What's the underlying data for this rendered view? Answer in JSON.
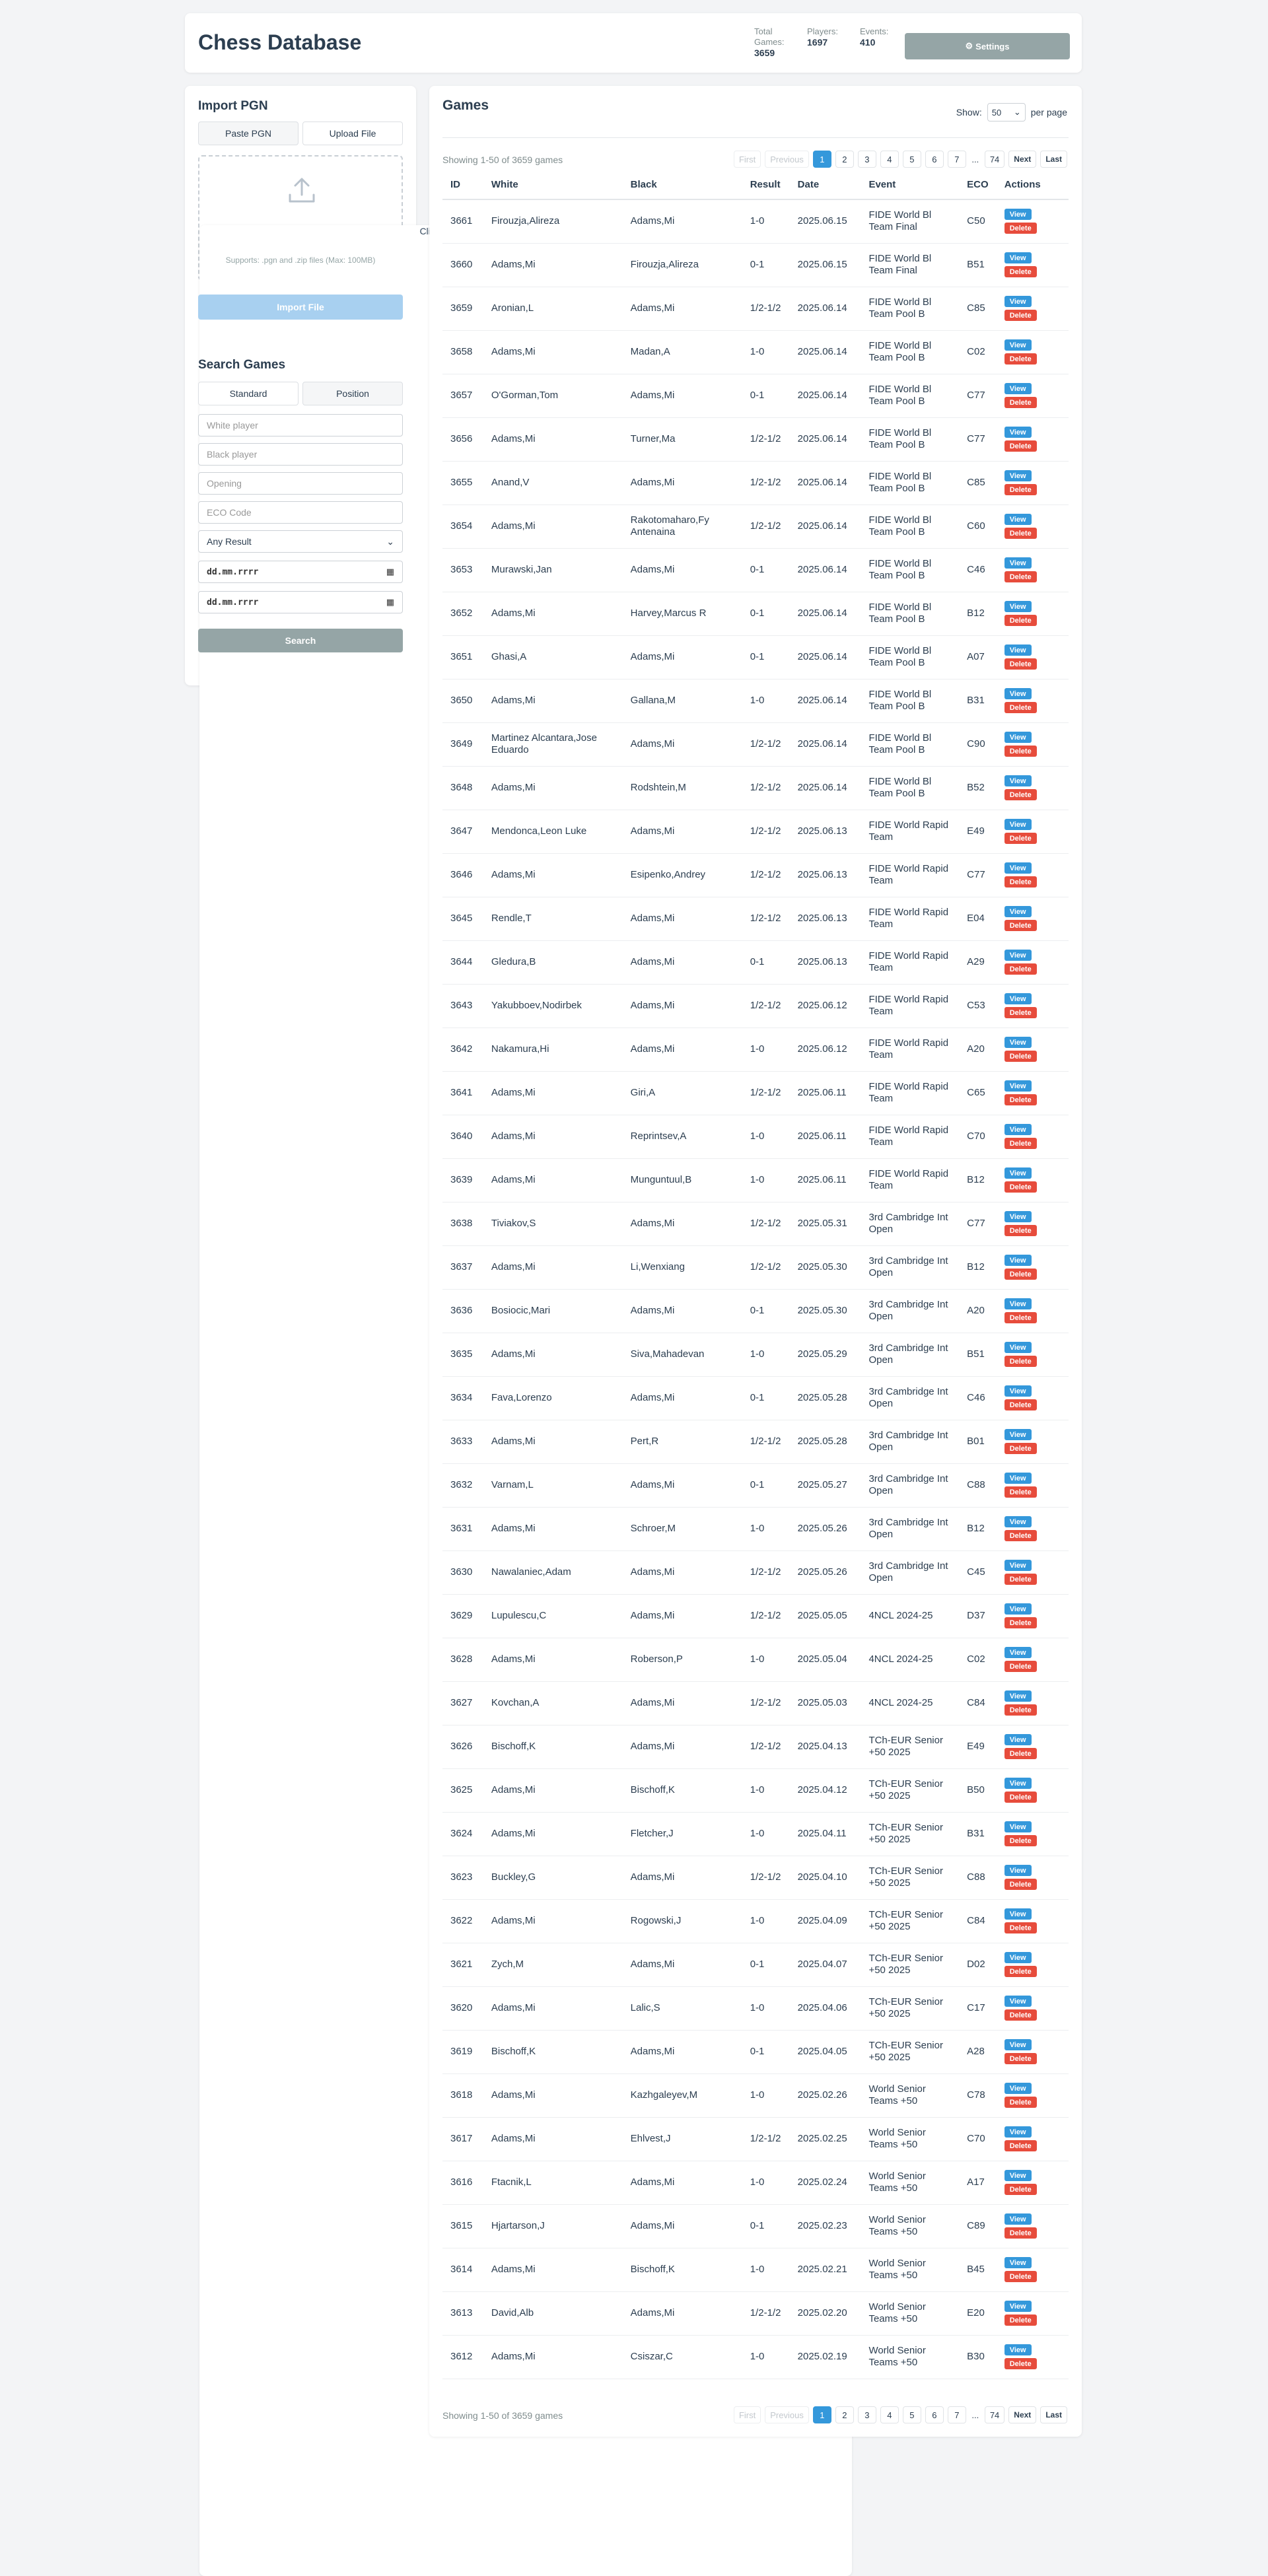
{
  "app": {
    "title": "Chess Database"
  },
  "stats": {
    "total_games_label": "Total Games:",
    "total_games": "3659",
    "players_label": "Players:",
    "players": "1697",
    "events_label": "Events:",
    "events": "410"
  },
  "settings_label": "Settings",
  "import": {
    "heading": "Import PGN",
    "tab_paste": "Paste PGN",
    "tab_upload": "Upload File",
    "drop_text": "Click to select a PGN or ZIP file or drag & drop here",
    "drop_sub": "Supports: .pgn and .zip files (Max: 100MB)",
    "import_button": "Import File"
  },
  "search": {
    "heading": "Search Games",
    "tab_standard": "Standard",
    "tab_position": "Position",
    "white_placeholder": "White player",
    "black_placeholder": "Black player",
    "opening_placeholder": "Opening",
    "eco_placeholder": "ECO Code",
    "result_selected": "Any Result",
    "date_from": "dd.mm.rrrr",
    "date_to": "dd.mm.rrrr",
    "search_button": "Search"
  },
  "games": {
    "heading": "Games",
    "show_label": "Show:",
    "per_page_value": "50",
    "per_page_label": "per page",
    "showing_text": "Showing 1-50 of 3659 games",
    "pagination": {
      "first": "First",
      "previous": "Previous",
      "pages": [
        "1",
        "2",
        "3",
        "4",
        "5",
        "6",
        "7"
      ],
      "ellipsis": "...",
      "last_page": "74",
      "next": "Next",
      "last": "Last"
    },
    "columns": [
      "ID",
      "White",
      "Black",
      "Result",
      "Date",
      "Event",
      "ECO",
      "Actions"
    ],
    "view_label": "View",
    "delete_label": "Delete",
    "rows": [
      [
        "3661",
        "Firouzja,Alireza",
        "Adams,Mi",
        "1-0",
        "2025.06.15",
        "FIDE World Bl Team Final",
        "C50"
      ],
      [
        "3660",
        "Adams,Mi",
        "Firouzja,Alireza",
        "0-1",
        "2025.06.15",
        "FIDE World Bl Team Final",
        "B51"
      ],
      [
        "3659",
        "Aronian,L",
        "Adams,Mi",
        "1/2-1/2",
        "2025.06.14",
        "FIDE World Bl Team Pool B",
        "C85"
      ],
      [
        "3658",
        "Adams,Mi",
        "Madan,A",
        "1-0",
        "2025.06.14",
        "FIDE World Bl Team Pool B",
        "C02"
      ],
      [
        "3657",
        "O'Gorman,Tom",
        "Adams,Mi",
        "0-1",
        "2025.06.14",
        "FIDE World Bl Team Pool B",
        "C77"
      ],
      [
        "3656",
        "Adams,Mi",
        "Turner,Ma",
        "1/2-1/2",
        "2025.06.14",
        "FIDE World Bl Team Pool B",
        "C77"
      ],
      [
        "3655",
        "Anand,V",
        "Adams,Mi",
        "1/2-1/2",
        "2025.06.14",
        "FIDE World Bl Team Pool B",
        "C85"
      ],
      [
        "3654",
        "Adams,Mi",
        "Rakotomaharo,Fy Antenaina",
        "1/2-1/2",
        "2025.06.14",
        "FIDE World Bl Team Pool B",
        "C60"
      ],
      [
        "3653",
        "Murawski,Jan",
        "Adams,Mi",
        "0-1",
        "2025.06.14",
        "FIDE World Bl Team Pool B",
        "C46"
      ],
      [
        "3652",
        "Adams,Mi",
        "Harvey,Marcus R",
        "0-1",
        "2025.06.14",
        "FIDE World Bl Team Pool B",
        "B12"
      ],
      [
        "3651",
        "Ghasi,A",
        "Adams,Mi",
        "0-1",
        "2025.06.14",
        "FIDE World Bl Team Pool B",
        "A07"
      ],
      [
        "3650",
        "Adams,Mi",
        "Gallana,M",
        "1-0",
        "2025.06.14",
        "FIDE World Bl Team Pool B",
        "B31"
      ],
      [
        "3649",
        "Martinez Alcantara,Jose Eduardo",
        "Adams,Mi",
        "1/2-1/2",
        "2025.06.14",
        "FIDE World Bl Team Pool B",
        "C90"
      ],
      [
        "3648",
        "Adams,Mi",
        "Rodshtein,M",
        "1/2-1/2",
        "2025.06.14",
        "FIDE World Bl Team Pool B",
        "B52"
      ],
      [
        "3647",
        "Mendonca,Leon Luke",
        "Adams,Mi",
        "1/2-1/2",
        "2025.06.13",
        "FIDE World Rapid Team",
        "E49"
      ],
      [
        "3646",
        "Adams,Mi",
        "Esipenko,Andrey",
        "1/2-1/2",
        "2025.06.13",
        "FIDE World Rapid Team",
        "C77"
      ],
      [
        "3645",
        "Rendle,T",
        "Adams,Mi",
        "1/2-1/2",
        "2025.06.13",
        "FIDE World Rapid Team",
        "E04"
      ],
      [
        "3644",
        "Gledura,B",
        "Adams,Mi",
        "0-1",
        "2025.06.13",
        "FIDE World Rapid Team",
        "A29"
      ],
      [
        "3643",
        "Yakubboev,Nodirbek",
        "Adams,Mi",
        "1/2-1/2",
        "2025.06.12",
        "FIDE World Rapid Team",
        "C53"
      ],
      [
        "3642",
        "Nakamura,Hi",
        "Adams,Mi",
        "1-0",
        "2025.06.12",
        "FIDE World Rapid Team",
        "A20"
      ],
      [
        "3641",
        "Adams,Mi",
        "Giri,A",
        "1/2-1/2",
        "2025.06.11",
        "FIDE World Rapid Team",
        "C65"
      ],
      [
        "3640",
        "Adams,Mi",
        "Reprintsev,A",
        "1-0",
        "2025.06.11",
        "FIDE World Rapid Team",
        "C70"
      ],
      [
        "3639",
        "Adams,Mi",
        "Munguntuul,B",
        "1-0",
        "2025.06.11",
        "FIDE World Rapid Team",
        "B12"
      ],
      [
        "3638",
        "Tiviakov,S",
        "Adams,Mi",
        "1/2-1/2",
        "2025.05.31",
        "3rd Cambridge Int Open",
        "C77"
      ],
      [
        "3637",
        "Adams,Mi",
        "Li,Wenxiang",
        "1/2-1/2",
        "2025.05.30",
        "3rd Cambridge Int Open",
        "B12"
      ],
      [
        "3636",
        "Bosiocic,Mari",
        "Adams,Mi",
        "0-1",
        "2025.05.30",
        "3rd Cambridge Int Open",
        "A20"
      ],
      [
        "3635",
        "Adams,Mi",
        "Siva,Mahadevan",
        "1-0",
        "2025.05.29",
        "3rd Cambridge Int Open",
        "B51"
      ],
      [
        "3634",
        "Fava,Lorenzo",
        "Adams,Mi",
        "0-1",
        "2025.05.28",
        "3rd Cambridge Int Open",
        "C46"
      ],
      [
        "3633",
        "Adams,Mi",
        "Pert,R",
        "1/2-1/2",
        "2025.05.28",
        "3rd Cambridge Int Open",
        "B01"
      ],
      [
        "3632",
        "Varnam,L",
        "Adams,Mi",
        "0-1",
        "2025.05.27",
        "3rd Cambridge Int Open",
        "C88"
      ],
      [
        "3631",
        "Adams,Mi",
        "Schroer,M",
        "1-0",
        "2025.05.26",
        "3rd Cambridge Int Open",
        "B12"
      ],
      [
        "3630",
        "Nawalaniec,Adam",
        "Adams,Mi",
        "1/2-1/2",
        "2025.05.26",
        "3rd Cambridge Int Open",
        "C45"
      ],
      [
        "3629",
        "Lupulescu,C",
        "Adams,Mi",
        "1/2-1/2",
        "2025.05.05",
        "4NCL 2024-25",
        "D37"
      ],
      [
        "3628",
        "Adams,Mi",
        "Roberson,P",
        "1-0",
        "2025.05.04",
        "4NCL 2024-25",
        "C02"
      ],
      [
        "3627",
        "Kovchan,A",
        "Adams,Mi",
        "1/2-1/2",
        "2025.05.03",
        "4NCL 2024-25",
        "C84"
      ],
      [
        "3626",
        "Bischoff,K",
        "Adams,Mi",
        "1/2-1/2",
        "2025.04.13",
        "TCh-EUR Senior +50 2025",
        "E49"
      ],
      [
        "3625",
        "Adams,Mi",
        "Bischoff,K",
        "1-0",
        "2025.04.12",
        "TCh-EUR Senior +50 2025",
        "B50"
      ],
      [
        "3624",
        "Adams,Mi",
        "Fletcher,J",
        "1-0",
        "2025.04.11",
        "TCh-EUR Senior +50 2025",
        "B31"
      ],
      [
        "3623",
        "Buckley,G",
        "Adams,Mi",
        "1/2-1/2",
        "2025.04.10",
        "TCh-EUR Senior +50 2025",
        "C88"
      ],
      [
        "3622",
        "Adams,Mi",
        "Rogowski,J",
        "1-0",
        "2025.04.09",
        "TCh-EUR Senior +50 2025",
        "C84"
      ],
      [
        "3621",
        "Zych,M",
        "Adams,Mi",
        "0-1",
        "2025.04.07",
        "TCh-EUR Senior +50 2025",
        "D02"
      ],
      [
        "3620",
        "Adams,Mi",
        "Lalic,S",
        "1-0",
        "2025.04.06",
        "TCh-EUR Senior +50 2025",
        "C17"
      ],
      [
        "3619",
        "Bischoff,K",
        "Adams,Mi",
        "0-1",
        "2025.04.05",
        "TCh-EUR Senior +50 2025",
        "A28"
      ],
      [
        "3618",
        "Adams,Mi",
        "Kazhgaleyev,M",
        "1-0",
        "2025.02.26",
        "World Senior Teams +50",
        "C78"
      ],
      [
        "3617",
        "Adams,Mi",
        "Ehlvest,J",
        "1/2-1/2",
        "2025.02.25",
        "World Senior Teams +50",
        "C70"
      ],
      [
        "3616",
        "Ftacnik,L",
        "Adams,Mi",
        "1-0",
        "2025.02.24",
        "World Senior Teams +50",
        "A17"
      ],
      [
        "3615",
        "Hjartarson,J",
        "Adams,Mi",
        "0-1",
        "2025.02.23",
        "World Senior Teams +50",
        "C89"
      ],
      [
        "3614",
        "Adams,Mi",
        "Bischoff,K",
        "1-0",
        "2025.02.21",
        "World Senior Teams +50",
        "B45"
      ],
      [
        "3613",
        "David,Alb",
        "Adams,Mi",
        "1/2-1/2",
        "2025.02.20",
        "World Senior Teams +50",
        "E20"
      ],
      [
        "3612",
        "Adams,Mi",
        "Csiszar,C",
        "1-0",
        "2025.02.19",
        "World Senior Teams +50",
        "B30"
      ]
    ]
  }
}
